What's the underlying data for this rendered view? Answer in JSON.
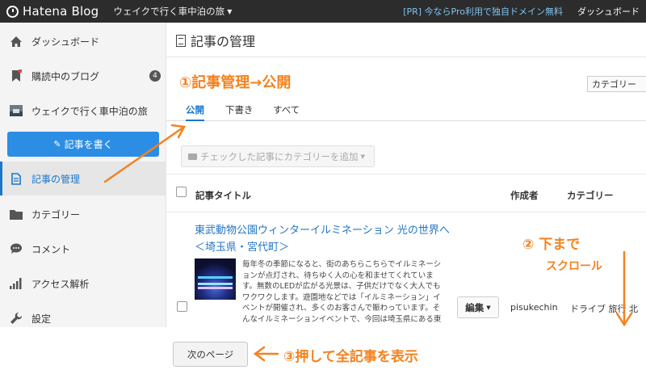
{
  "topbar": {
    "logo": "Hatena Blog",
    "blog_name": "ウェイクで行く車中泊の旅",
    "pr_link": "[PR] 今ならPro利用で独自ドメイン無料",
    "dashboard": "ダッシュボード"
  },
  "sidebar": {
    "items": [
      {
        "label": "ダッシュボード",
        "icon": "home-icon"
      },
      {
        "label": "購読中のブログ",
        "icon": "bookmark-icon",
        "badge": "4"
      },
      {
        "label": "ウェイクで行く車中泊の旅",
        "icon": "blog-thumbnail-icon"
      },
      {
        "label": "記事の管理",
        "icon": "document-icon",
        "active": true
      },
      {
        "label": "カテゴリー",
        "icon": "folder-icon"
      },
      {
        "label": "コメント",
        "icon": "comment-icon"
      },
      {
        "label": "アクセス解析",
        "icon": "bar-chart-icon"
      },
      {
        "label": "設定",
        "icon": "wrench-icon"
      }
    ],
    "write_button": "記事を書く"
  },
  "main": {
    "title": "記事の管理",
    "category_filter": "カテゴリー",
    "tabs": [
      {
        "label": "公開",
        "active": true
      },
      {
        "label": "下書き"
      },
      {
        "label": "すべて"
      }
    ],
    "add_category": "チェックした記事にカテゴリーを追加",
    "columns": {
      "title": "記事タイトル",
      "author": "作成者",
      "category": "カテゴリー"
    },
    "entry": {
      "title": "東武動物公園ウィンターイルミネーション 光の世界へ ＜埼玉県・宮代町＞",
      "excerpt": "毎年冬の季節になると、街のあちらこちらでイルミネーションが点灯され、待ちゆく人の心を和ませてくれています。無数のLEDが広がる光景は、子供だけでなく大人でもワクワクします。遊園地などでは「イルミネーション」イベントが開催され、多くのお客さんで賑わっています。そんなイルミネーションイベントで、今回は埼玉県にある東武",
      "edit": "編集",
      "author": "pisukechin",
      "category": "ドライブ 旅行 北"
    },
    "next_page": "次のページ"
  },
  "annotations": {
    "step1": "①記事管理→公開",
    "step2_line1": "② 下まで",
    "step2_line2": "スクロール",
    "step3": "③押して全記事を表示",
    "color": "#f4821f"
  },
  "colors": {
    "accent": "#1a77c9",
    "write_button": "#2b8ee4",
    "topbar": "#2c2c2c"
  }
}
